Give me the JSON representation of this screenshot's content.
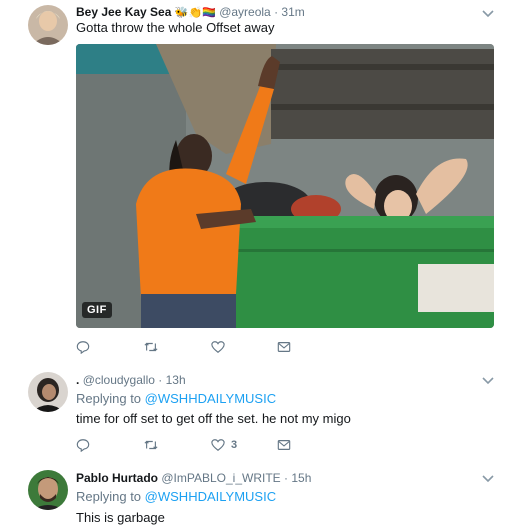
{
  "tweets": [
    {
      "name": "Bey Jee Kay Sea",
      "emoji": "🐝👏🏳️‍🌈",
      "handle": "@ayreola",
      "time": "31m",
      "text": "Gotta throw the whole Offset away",
      "media_badge": "GIF",
      "actions": {
        "reply_count": "",
        "retweet_count": "",
        "like_count": ""
      }
    },
    {
      "name": ".",
      "handle": "@cloudygallo",
      "time": "13h",
      "replying_label": "Replying to",
      "replying_to": "@WSHHDAILYMUSIC",
      "text": "time for off set to get off the set. he not my migo",
      "actions": {
        "reply_count": "",
        "retweet_count": "",
        "like_count": "3"
      }
    },
    {
      "name": "Pablo Hurtado",
      "handle": "@ImPABLO_i_WRITE",
      "time": "15h",
      "replying_label": "Replying to",
      "replying_to": "@WSHHDAILYMUSIC",
      "text": "This is garbage"
    }
  ],
  "separator": "·",
  "colors": {
    "link": "#1da1f2",
    "muted": "#657786",
    "divider": "#e6ecf0",
    "dumpster_green": "#2f8f44",
    "shirt_orange": "#f07a18"
  },
  "icons": {
    "reply": "reply-icon",
    "retweet": "retweet-icon",
    "like": "heart-icon",
    "dm": "envelope-icon",
    "menu": "chevron-down-icon"
  }
}
